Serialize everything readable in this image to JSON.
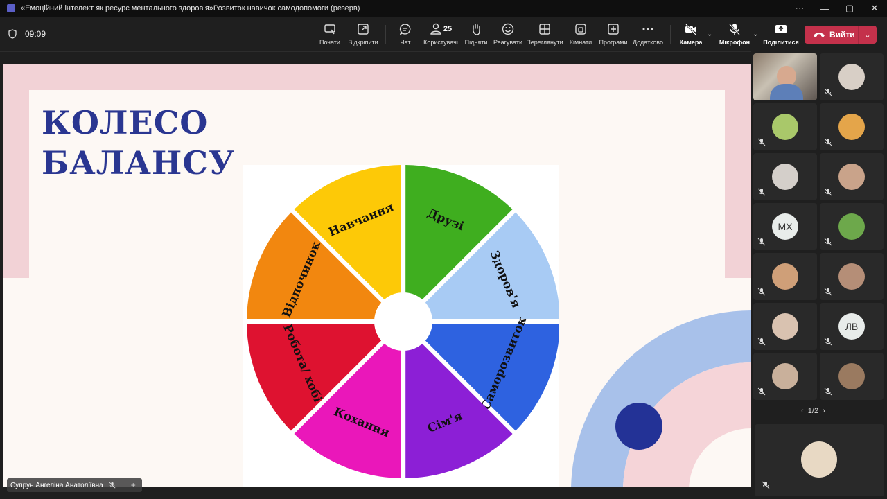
{
  "window": {
    "title": "«Емоційний інтелект як ресурс ментального здоров’я»Розвиток навичок самодопомоги (резерв)"
  },
  "meeting": {
    "elapsed": "09:09",
    "participants_count": "25"
  },
  "toolbar": {
    "record": "Почати",
    "popout": "Відкріпити",
    "chat": "Чат",
    "people": "Користувачі",
    "raise": "Підняти",
    "react": "Реагувати",
    "view": "Переглянути",
    "rooms": "Кімнати",
    "apps": "Програми",
    "more": "Додатково",
    "camera": "Камера",
    "mic": "Мікрофон",
    "share": "Поділитися",
    "leave": "Вийти"
  },
  "slide": {
    "title_line1": "КОЛЕСО",
    "title_line2": "БАЛАНСУ",
    "wheel_segments": [
      {
        "label": "Друзі",
        "color": "#3fae1f"
      },
      {
        "label": "Здоров'я",
        "color": "#a8cbf4"
      },
      {
        "label": "Саморозвиток",
        "color": "#2e62e0"
      },
      {
        "label": "Сім'я",
        "color": "#8c1fd6"
      },
      {
        "label": "Кохання",
        "color": "#ea17ba"
      },
      {
        "label": "Робота/ хобі",
        "color": "#de1230"
      },
      {
        "label": "Відпочинок",
        "color": "#f2870f"
      },
      {
        "label": "Навчання",
        "color": "#fdc907"
      }
    ]
  },
  "gallery": {
    "tiles": [
      {
        "kind": "video",
        "muted": false
      },
      {
        "kind": "photo",
        "muted": true,
        "color": "#d8cfc6"
      },
      {
        "kind": "photo",
        "muted": true,
        "color": "#a9c86a"
      },
      {
        "kind": "photo",
        "muted": true,
        "color": "#e4a54a"
      },
      {
        "kind": "photo",
        "muted": true,
        "color": "#d4cfca"
      },
      {
        "kind": "photo",
        "muted": true,
        "color": "#c9a38a"
      },
      {
        "kind": "initials",
        "initials": "МХ",
        "muted": true
      },
      {
        "kind": "photo",
        "muted": true,
        "color": "#6da84b"
      },
      {
        "kind": "photo",
        "muted": true,
        "color": "#cf9f78"
      },
      {
        "kind": "photo",
        "muted": true,
        "color": "#b58e77"
      },
      {
        "kind": "photo",
        "muted": true,
        "color": "#d9c2b0"
      },
      {
        "kind": "initials",
        "initials": "ЛВ",
        "muted": true
      },
      {
        "kind": "photo",
        "muted": true,
        "color": "#c9b09b"
      },
      {
        "kind": "photo",
        "muted": true,
        "color": "#9a7a60"
      }
    ],
    "pager": "1/2",
    "self_tile": {
      "muted": true,
      "color": "#e8d9c4"
    }
  },
  "presenter": {
    "name": "Супрун Ангеліна Анатоліївна"
  }
}
